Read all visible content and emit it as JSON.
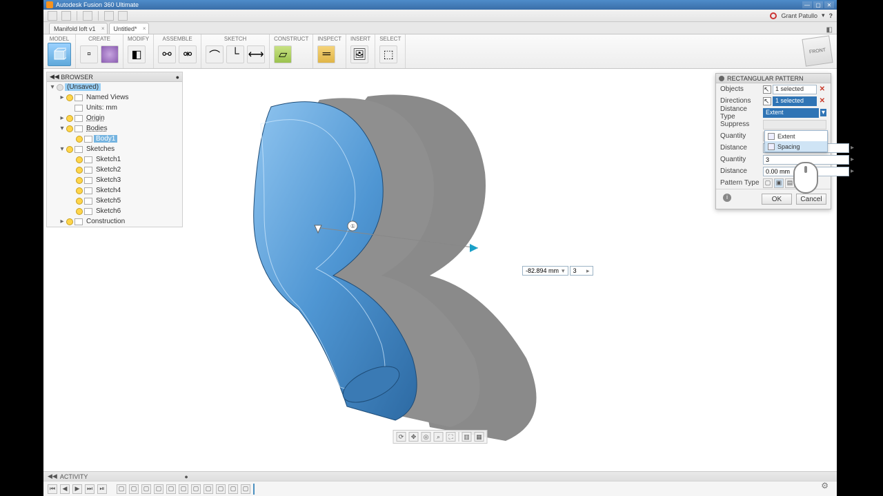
{
  "app_title": "Autodesk Fusion 360 Ultimate",
  "user_name": "Grant Patullo",
  "tabs": [
    {
      "label": "Manifold loft v1",
      "active": false
    },
    {
      "label": "Untitled*",
      "active": true
    }
  ],
  "ribbon_groups": [
    "MODEL",
    "CREATE",
    "MODIFY",
    "ASSEMBLE",
    "SKETCH",
    "CONSTRUCT",
    "INSPECT",
    "INSERT",
    "SELECT"
  ],
  "browser": {
    "title": "BROWSER",
    "root": "(Unsaved)",
    "items": [
      {
        "indent": 1,
        "twisty": "▸",
        "bulb": true,
        "name": "Named Views"
      },
      {
        "indent": 1,
        "twisty": "",
        "bulb": false,
        "name": "Units: mm"
      },
      {
        "indent": 1,
        "twisty": "▸",
        "bulb": true,
        "name": "Origin",
        "dash": true
      },
      {
        "indent": 1,
        "twisty": "▾",
        "bulb": true,
        "name": "Bodies",
        "dash": true
      },
      {
        "indent": 2,
        "twisty": "",
        "bulb": true,
        "name": "Body1",
        "selected": true
      },
      {
        "indent": 1,
        "twisty": "▾",
        "bulb": true,
        "name": "Sketches"
      },
      {
        "indent": 2,
        "twisty": "",
        "bulb": true,
        "name": "Sketch1"
      },
      {
        "indent": 2,
        "twisty": "",
        "bulb": true,
        "name": "Sketch2"
      },
      {
        "indent": 2,
        "twisty": "",
        "bulb": true,
        "name": "Sketch3"
      },
      {
        "indent": 2,
        "twisty": "",
        "bulb": true,
        "name": "Sketch4"
      },
      {
        "indent": 2,
        "twisty": "",
        "bulb": true,
        "name": "Sketch5"
      },
      {
        "indent": 2,
        "twisty": "",
        "bulb": true,
        "name": "Sketch6"
      },
      {
        "indent": 1,
        "twisty": "▸",
        "bulb": true,
        "name": "Construction"
      }
    ]
  },
  "panel": {
    "title": "RECTANGULAR PATTERN",
    "rows": [
      {
        "label": "Objects",
        "type": "select",
        "value": "1 selected",
        "clear": true
      },
      {
        "label": "Directions",
        "type": "select",
        "value": "1 selected",
        "clear": true,
        "highlighted": true
      },
      {
        "label": "Distance Type",
        "type": "combo",
        "value": "Extent"
      },
      {
        "label": "Suppress",
        "type": "readonly",
        "value": ""
      },
      {
        "label": "Quantity",
        "type": "readonly",
        "value": ""
      },
      {
        "label": "Distance",
        "type": "input",
        "value": "-82.894 mm"
      },
      {
        "label": "Quantity",
        "type": "input",
        "value": "3"
      },
      {
        "label": "Distance",
        "type": "input",
        "value": "0.00 mm"
      },
      {
        "label": "Pattern Type",
        "type": "icons",
        "value": ""
      }
    ],
    "dropdown": {
      "options": [
        "Extent",
        "Spacing"
      ],
      "highlight": 1
    },
    "ok": "OK",
    "cancel": "Cancel"
  },
  "float_inputs": {
    "distance": "-82.894 mm",
    "quantity": "3"
  },
  "viewcube": "FRONT",
  "activity": "ACTIVITY",
  "qat_icons": [
    "grid-icon",
    "file-new-icon",
    "save-icon",
    "undo-icon",
    "redo-icon"
  ],
  "nav_icons": [
    "orbit-icon",
    "pan-icon",
    "lookat-icon",
    "zoom-icon",
    "fit-icon",
    "display-icon",
    "grid-icon"
  ],
  "timeline_controls": [
    "⏮",
    "◀",
    "▶",
    "⏭",
    "⏯"
  ]
}
